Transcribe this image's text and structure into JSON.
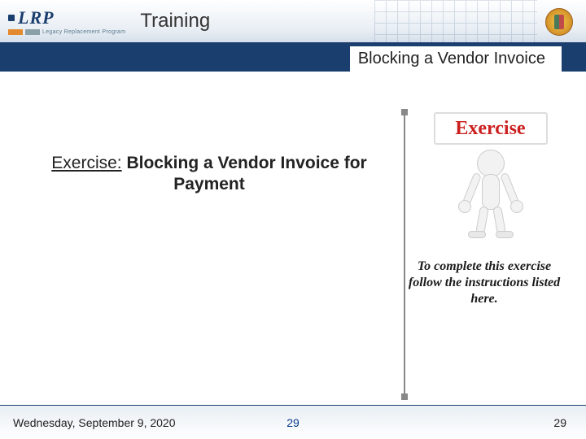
{
  "header": {
    "logo_text": "LRP",
    "logo_subtitle": "Legacy Replacement Program",
    "title": "Training"
  },
  "subheader": "Blocking a Vendor Invoice",
  "exercise": {
    "label": "Exercise:",
    "title_line1": "Blocking a Vendor Invoice for",
    "title_line2": "Payment",
    "sign": "Exercise",
    "instructions": "To complete this exercise follow the instructions listed here."
  },
  "footer": {
    "date": "Wednesday, September 9, 2020",
    "center": "29",
    "right": "29"
  }
}
